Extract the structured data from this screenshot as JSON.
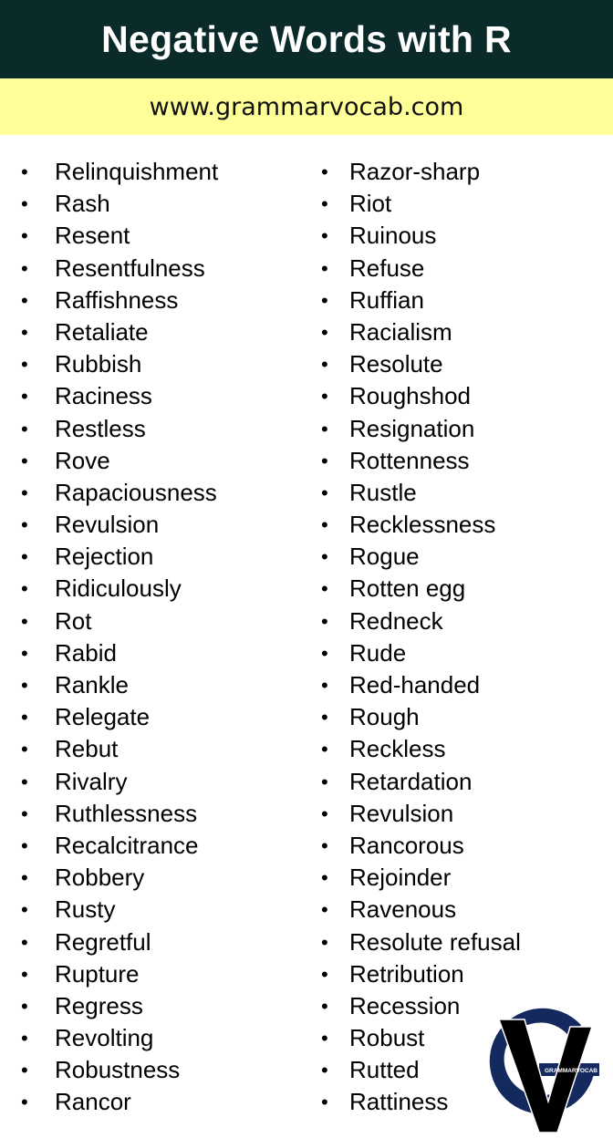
{
  "header": {
    "title": "Negative Words with R"
  },
  "banner": {
    "url_text": "www.grammarvocab.com"
  },
  "colors": {
    "header_bg": "#0b2b2a",
    "banner_bg": "#ffff99",
    "logo_blue": "#14295e"
  },
  "bullet_glyph": "•",
  "left_column": [
    "Relinquishment",
    "Rash",
    "Resent",
    "Resentfulness",
    "Raffishness",
    "Retaliate",
    "Rubbish",
    "Raciness",
    "Restless",
    "Rove",
    "Rapaciousness",
    "Revulsion",
    "Rejection",
    "Ridiculously",
    "Rot",
    "Rabid",
    "Rankle",
    "Relegate",
    "Rebut",
    "Rivalry",
    "Ruthlessness",
    "Recalcitrance",
    "Robbery",
    "Rusty",
    "Regretful",
    "Rupture",
    "Regress",
    "Revolting",
    "Robustness",
    "Rancor"
  ],
  "right_column": [
    "Razor-sharp",
    "Riot",
    "Ruinous",
    "Refuse",
    "Ruffian",
    "Racialism",
    "Resolute",
    "Roughshod",
    "Resignation",
    "Rottenness",
    "Rustle",
    "Recklessness",
    "Rogue",
    "Rotten egg",
    "Redneck",
    "Rude",
    "Red-handed",
    "Rough",
    "Reckless",
    "Retardation",
    "Revulsion",
    "Rancorous",
    "Rejoinder",
    "Ravenous",
    "Resolute refusal",
    "Retribution",
    "Recession",
    "Robust",
    "Rutted",
    "Rattiness"
  ],
  "logo": {
    "icon": "grammarvocab-logo-icon",
    "label": "GRAMMARVOCAB"
  }
}
